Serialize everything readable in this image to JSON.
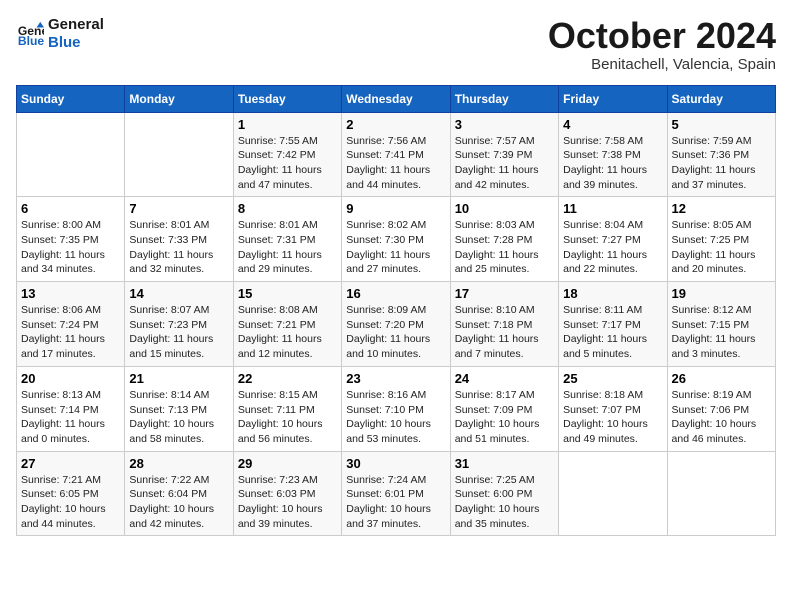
{
  "logo": {
    "line1": "General",
    "line2": "Blue"
  },
  "title": "October 2024",
  "subtitle": "Benitachell, Valencia, Spain",
  "days_header": [
    "Sunday",
    "Monday",
    "Tuesday",
    "Wednesday",
    "Thursday",
    "Friday",
    "Saturday"
  ],
  "weeks": [
    [
      {
        "num": "",
        "info": ""
      },
      {
        "num": "",
        "info": ""
      },
      {
        "num": "1",
        "info": "Sunrise: 7:55 AM\nSunset: 7:42 PM\nDaylight: 11 hours and 47 minutes."
      },
      {
        "num": "2",
        "info": "Sunrise: 7:56 AM\nSunset: 7:41 PM\nDaylight: 11 hours and 44 minutes."
      },
      {
        "num": "3",
        "info": "Sunrise: 7:57 AM\nSunset: 7:39 PM\nDaylight: 11 hours and 42 minutes."
      },
      {
        "num": "4",
        "info": "Sunrise: 7:58 AM\nSunset: 7:38 PM\nDaylight: 11 hours and 39 minutes."
      },
      {
        "num": "5",
        "info": "Sunrise: 7:59 AM\nSunset: 7:36 PM\nDaylight: 11 hours and 37 minutes."
      }
    ],
    [
      {
        "num": "6",
        "info": "Sunrise: 8:00 AM\nSunset: 7:35 PM\nDaylight: 11 hours and 34 minutes."
      },
      {
        "num": "7",
        "info": "Sunrise: 8:01 AM\nSunset: 7:33 PM\nDaylight: 11 hours and 32 minutes."
      },
      {
        "num": "8",
        "info": "Sunrise: 8:01 AM\nSunset: 7:31 PM\nDaylight: 11 hours and 29 minutes."
      },
      {
        "num": "9",
        "info": "Sunrise: 8:02 AM\nSunset: 7:30 PM\nDaylight: 11 hours and 27 minutes."
      },
      {
        "num": "10",
        "info": "Sunrise: 8:03 AM\nSunset: 7:28 PM\nDaylight: 11 hours and 25 minutes."
      },
      {
        "num": "11",
        "info": "Sunrise: 8:04 AM\nSunset: 7:27 PM\nDaylight: 11 hours and 22 minutes."
      },
      {
        "num": "12",
        "info": "Sunrise: 8:05 AM\nSunset: 7:25 PM\nDaylight: 11 hours and 20 minutes."
      }
    ],
    [
      {
        "num": "13",
        "info": "Sunrise: 8:06 AM\nSunset: 7:24 PM\nDaylight: 11 hours and 17 minutes."
      },
      {
        "num": "14",
        "info": "Sunrise: 8:07 AM\nSunset: 7:23 PM\nDaylight: 11 hours and 15 minutes."
      },
      {
        "num": "15",
        "info": "Sunrise: 8:08 AM\nSunset: 7:21 PM\nDaylight: 11 hours and 12 minutes."
      },
      {
        "num": "16",
        "info": "Sunrise: 8:09 AM\nSunset: 7:20 PM\nDaylight: 11 hours and 10 minutes."
      },
      {
        "num": "17",
        "info": "Sunrise: 8:10 AM\nSunset: 7:18 PM\nDaylight: 11 hours and 7 minutes."
      },
      {
        "num": "18",
        "info": "Sunrise: 8:11 AM\nSunset: 7:17 PM\nDaylight: 11 hours and 5 minutes."
      },
      {
        "num": "19",
        "info": "Sunrise: 8:12 AM\nSunset: 7:15 PM\nDaylight: 11 hours and 3 minutes."
      }
    ],
    [
      {
        "num": "20",
        "info": "Sunrise: 8:13 AM\nSunset: 7:14 PM\nDaylight: 11 hours and 0 minutes."
      },
      {
        "num": "21",
        "info": "Sunrise: 8:14 AM\nSunset: 7:13 PM\nDaylight: 10 hours and 58 minutes."
      },
      {
        "num": "22",
        "info": "Sunrise: 8:15 AM\nSunset: 7:11 PM\nDaylight: 10 hours and 56 minutes."
      },
      {
        "num": "23",
        "info": "Sunrise: 8:16 AM\nSunset: 7:10 PM\nDaylight: 10 hours and 53 minutes."
      },
      {
        "num": "24",
        "info": "Sunrise: 8:17 AM\nSunset: 7:09 PM\nDaylight: 10 hours and 51 minutes."
      },
      {
        "num": "25",
        "info": "Sunrise: 8:18 AM\nSunset: 7:07 PM\nDaylight: 10 hours and 49 minutes."
      },
      {
        "num": "26",
        "info": "Sunrise: 8:19 AM\nSunset: 7:06 PM\nDaylight: 10 hours and 46 minutes."
      }
    ],
    [
      {
        "num": "27",
        "info": "Sunrise: 7:21 AM\nSunset: 6:05 PM\nDaylight: 10 hours and 44 minutes."
      },
      {
        "num": "28",
        "info": "Sunrise: 7:22 AM\nSunset: 6:04 PM\nDaylight: 10 hours and 42 minutes."
      },
      {
        "num": "29",
        "info": "Sunrise: 7:23 AM\nSunset: 6:03 PM\nDaylight: 10 hours and 39 minutes."
      },
      {
        "num": "30",
        "info": "Sunrise: 7:24 AM\nSunset: 6:01 PM\nDaylight: 10 hours and 37 minutes."
      },
      {
        "num": "31",
        "info": "Sunrise: 7:25 AM\nSunset: 6:00 PM\nDaylight: 10 hours and 35 minutes."
      },
      {
        "num": "",
        "info": ""
      },
      {
        "num": "",
        "info": ""
      }
    ]
  ]
}
